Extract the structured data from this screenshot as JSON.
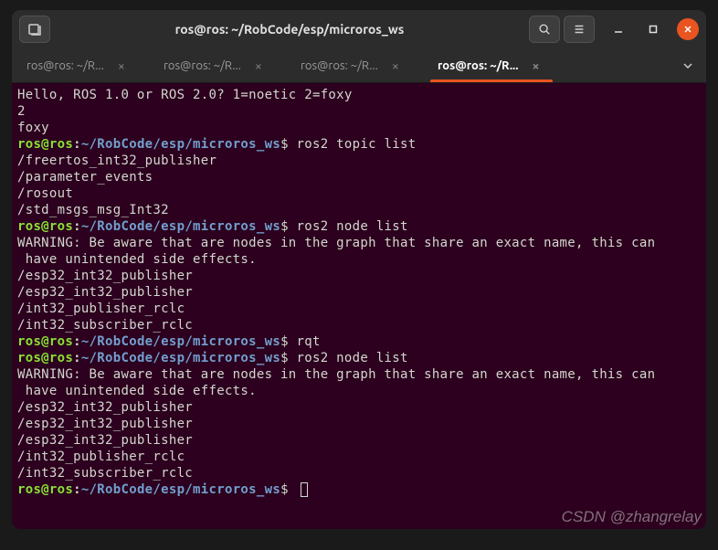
{
  "window": {
    "title": "ros@ros: ~/RobCode/esp/microros_ws"
  },
  "tabs": [
    {
      "label": "ros@ros: ~/R...",
      "active": false
    },
    {
      "label": "ros@ros: ~/R...",
      "active": false
    },
    {
      "label": "ros@ros: ~/R...",
      "active": false
    },
    {
      "label": "ros@ros: ~/R...",
      "active": true
    }
  ],
  "prompt": {
    "user": "ros@ros",
    "path": "~/RobCode/esp/microros_ws",
    "symbol": "$"
  },
  "terminal_lines": [
    {
      "type": "out",
      "text": "Hello, ROS 1.0 or ROS 2.0? 1=noetic 2=foxy"
    },
    {
      "type": "out",
      "text": "2"
    },
    {
      "type": "out",
      "text": "foxy"
    },
    {
      "type": "prompt",
      "cmd": " ros2 topic list"
    },
    {
      "type": "out",
      "text": "/freertos_int32_publisher"
    },
    {
      "type": "out",
      "text": "/parameter_events"
    },
    {
      "type": "out",
      "text": "/rosout"
    },
    {
      "type": "out",
      "text": "/std_msgs_msg_Int32"
    },
    {
      "type": "prompt",
      "cmd": " ros2 node list"
    },
    {
      "type": "out",
      "text": "WARNING: Be aware that are nodes in the graph that share an exact name, this can"
    },
    {
      "type": "out",
      "text": " have unintended side effects."
    },
    {
      "type": "out",
      "text": "/esp32_int32_publisher"
    },
    {
      "type": "out",
      "text": "/esp32_int32_publisher"
    },
    {
      "type": "out",
      "text": "/int32_publisher_rclc"
    },
    {
      "type": "out",
      "text": "/int32_subscriber_rclc"
    },
    {
      "type": "prompt",
      "cmd": " rqt"
    },
    {
      "type": "prompt",
      "cmd": " ros2 node list"
    },
    {
      "type": "out",
      "text": "WARNING: Be aware that are nodes in the graph that share an exact name, this can"
    },
    {
      "type": "out",
      "text": " have unintended side effects."
    },
    {
      "type": "out",
      "text": "/esp32_int32_publisher"
    },
    {
      "type": "out",
      "text": "/esp32_int32_publisher"
    },
    {
      "type": "out",
      "text": "/esp32_int32_publisher"
    },
    {
      "type": "out",
      "text": "/int32_publisher_rclc"
    },
    {
      "type": "out",
      "text": "/int32_subscriber_rclc"
    },
    {
      "type": "prompt",
      "cmd": " ",
      "cursor": true
    }
  ],
  "watermark": "CSDN @zhangrelay"
}
